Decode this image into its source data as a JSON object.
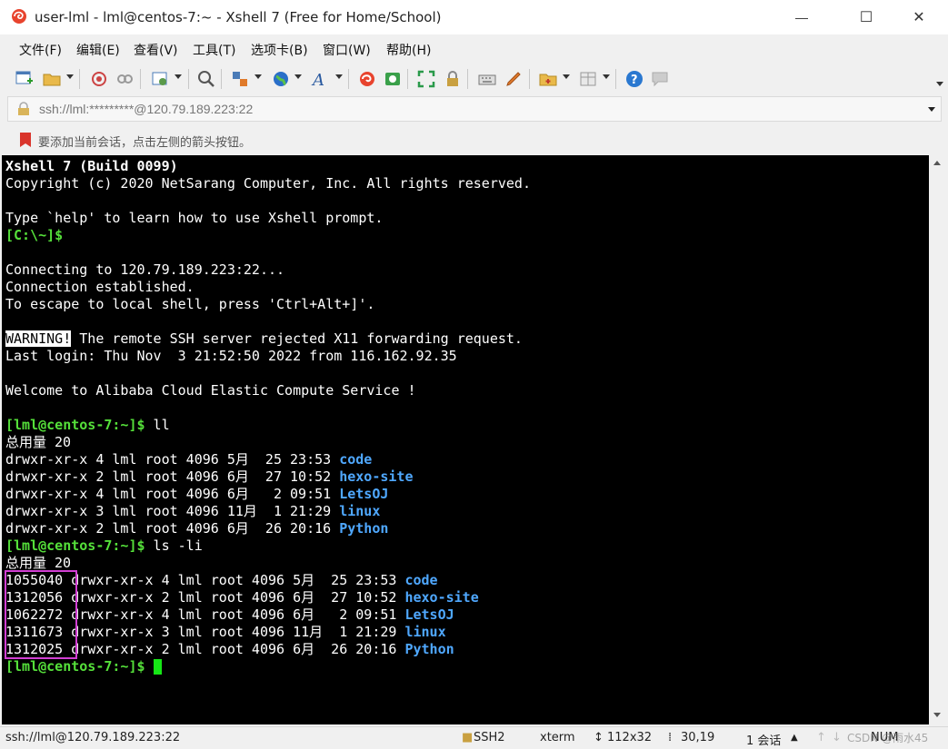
{
  "window": {
    "title": "user-lml - lml@centos-7:~ - Xshell 7 (Free for Home/School)",
    "minimize": "—",
    "maximize": "☐",
    "close": "✕"
  },
  "menu": {
    "items": [
      "文件(F)",
      "编辑(E)",
      "查看(V)",
      "工具(T)",
      "选项卡(B)",
      "窗口(W)",
      "帮助(H)"
    ]
  },
  "address": {
    "value": "ssh://lml:*********@120.79.189.223:22"
  },
  "hint": {
    "text": "要添加当前会话，点击左侧的箭头按钮。"
  },
  "terminal": {
    "banner1": "Xshell 7 (Build 0099)",
    "banner2": "Copyright (c) 2020 NetSarang Computer, Inc. All rights reserved.",
    "help": "Type `help' to learn how to use Xshell prompt.",
    "local_prompt": "[C:\\~]$",
    "connecting": "Connecting to 120.79.189.223:22...",
    "established": "Connection established.",
    "escape": "To escape to local shell, press 'Ctrl+Alt+]'.",
    "warning_tag": "WARNING!",
    "warning_text": " The remote SSH server rejected X11 forwarding request.",
    "last_login": "Last login: Thu Nov  3 21:52:50 2022 from 116.162.92.35",
    "welcome": "Welcome to Alibaba Cloud Elastic Compute Service !",
    "prompt": "[lml@centos-7:~]$",
    "cmd1": " ll",
    "total": "总用量 20",
    "ll_rows": [
      {
        "meta": "drwxr-xr-x 4 lml root 4096 5月  25 23:53 ",
        "name": "code"
      },
      {
        "meta": "drwxr-xr-x 2 lml root 4096 6月  27 10:52 ",
        "name": "hexo-site"
      },
      {
        "meta": "drwxr-xr-x 4 lml root 4096 6月   2 09:51 ",
        "name": "LetsOJ"
      },
      {
        "meta": "drwxr-xr-x 3 lml root 4096 11月  1 21:29 ",
        "name": "linux"
      },
      {
        "meta": "drwxr-xr-x 2 lml root 4096 6月  26 20:16 ",
        "name": "Python"
      }
    ],
    "cmd2": " ls -li",
    "li_rows": [
      {
        "inode": "1055040",
        "meta": " drwxr-xr-x 4 lml root 4096 5月  25 23:53 ",
        "name": "code"
      },
      {
        "inode": "1312056",
        "meta": " drwxr-xr-x 2 lml root 4096 6月  27 10:52 ",
        "name": "hexo-site"
      },
      {
        "inode": "1062272",
        "meta": " drwxr-xr-x 4 lml root 4096 6月   2 09:51 ",
        "name": "LetsOJ"
      },
      {
        "inode": "1311673",
        "meta": " drwxr-xr-x 3 lml root 4096 11月  1 21:29 ",
        "name": "linux"
      },
      {
        "inode": "1312025",
        "meta": " drwxr-xr-x 2 lml root 4096 6月  26 20:16 ",
        "name": "Python"
      }
    ],
    "final_prompt": "[lml@centos-7:~]$ ",
    "highlight_color": "#d23fd3"
  },
  "status": {
    "connection": "ssh://lml@120.79.189.223:22",
    "protocol": "SSH2",
    "term": "xterm",
    "size": "112x32",
    "cursor": "30,19",
    "sessions": "1 会话",
    "num": "NUM",
    "watermark": "CSDN @雨水45"
  },
  "colors": {
    "prompt_green": "#55e03a",
    "dir_blue": "#4fa8ff",
    "cursor_green": "#16e616"
  }
}
